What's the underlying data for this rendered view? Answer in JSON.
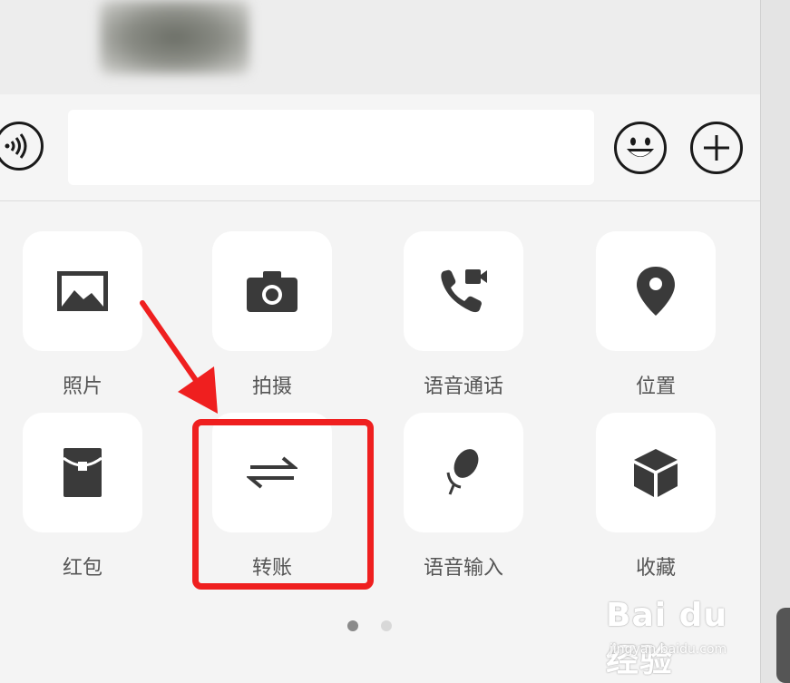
{
  "panel": {
    "row1": [
      {
        "label": "照片",
        "icon": "photo-icon"
      },
      {
        "label": "拍摄",
        "icon": "camera-icon"
      },
      {
        "label": "语音通话",
        "icon": "voice-video-call-icon"
      },
      {
        "label": "位置",
        "icon": "location-pin-icon"
      }
    ],
    "row2": [
      {
        "label": "红包",
        "icon": "red-packet-icon"
      },
      {
        "label": "转账",
        "icon": "transfer-arrows-icon"
      },
      {
        "label": "语音输入",
        "icon": "microphone-icon"
      },
      {
        "label": "收藏",
        "icon": "favorites-cube-icon"
      }
    ]
  },
  "pager": {
    "pages": 2,
    "current": 1
  },
  "watermark": {
    "logo": "Bai du 经验",
    "url": "jingyan.baidu.com"
  },
  "colors": {
    "highlight": "#ef1f1f",
    "icon": "#3a3a3a",
    "tile": "#ffffff",
    "panel": "#f4f4f4"
  }
}
